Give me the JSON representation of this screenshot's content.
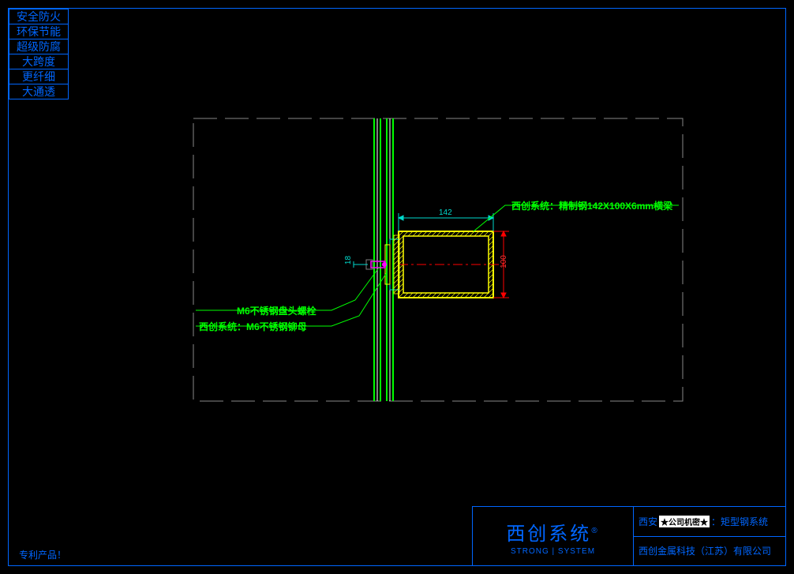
{
  "side_tabs": [
    "安全防火",
    "环保节能",
    "超级防腐",
    "大跨度",
    "更纤细",
    "大通透"
  ],
  "labels": {
    "beam": "西创系统：精制钢142X100X6mm横梁",
    "bolt": "M6不锈钢盘头螺栓",
    "rivet": "西创系统：M6不锈钢铆母"
  },
  "dims": {
    "width": "142",
    "height": "100",
    "offset": "18"
  },
  "title_block": {
    "logo_main": "西创系统",
    "logo_reg": "®",
    "logo_sub": "STRONG | SYSTEM",
    "project_prefix": "西安",
    "secret": "★公司机密★",
    "project_suffix": "：矩型钢系统",
    "company": "西创金属科技（江苏）有限公司"
  },
  "patent_text": "专利产品！"
}
